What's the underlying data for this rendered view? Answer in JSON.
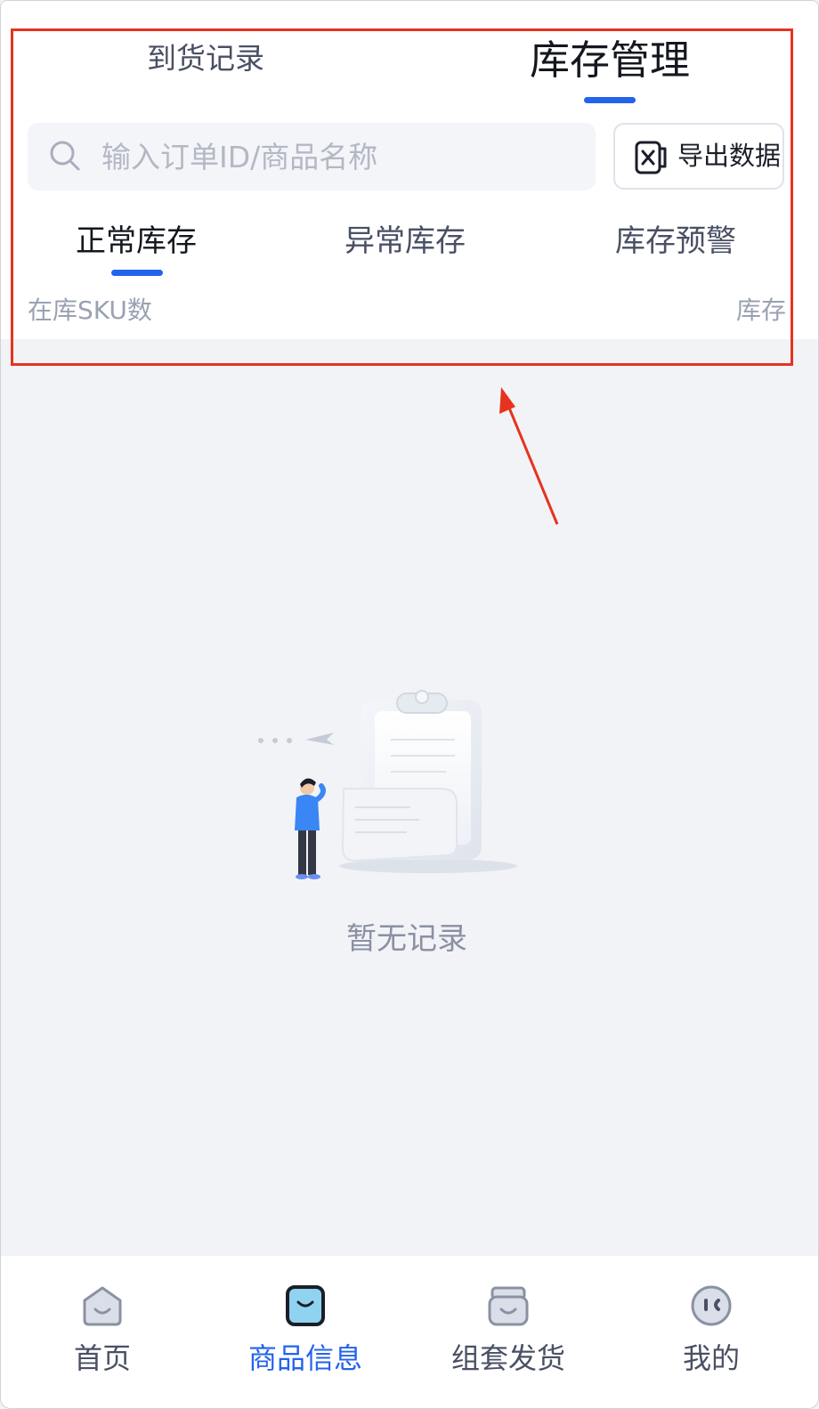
{
  "tabs": {
    "arrival_records": "到货记录",
    "inventory_management": "库存管理",
    "active": "inventory_management"
  },
  "search": {
    "placeholder": "输入订单ID/商品名称"
  },
  "export": {
    "label": "导出数据",
    "icon": "excel-icon"
  },
  "sub_tabs": {
    "normal": "正常库存",
    "abnormal": "异常库存",
    "warning": "库存预警",
    "active": "normal"
  },
  "table": {
    "columns": [
      "在库SKU数",
      "库存"
    ]
  },
  "empty_state": {
    "text": "暂无记录",
    "illustration": "empty-clipboard-illustration"
  },
  "bottom_nav": {
    "items": [
      {
        "label": "首页",
        "icon": "home-icon"
      },
      {
        "label": "商品信息",
        "icon": "product-icon"
      },
      {
        "label": "组套发货",
        "icon": "bundle-shipping-icon"
      },
      {
        "label": "我的",
        "icon": "profile-icon"
      }
    ],
    "active_index": 1
  },
  "colors": {
    "accent": "#2463eb",
    "annotation": "#e6331f",
    "background": "#f2f3f7"
  }
}
